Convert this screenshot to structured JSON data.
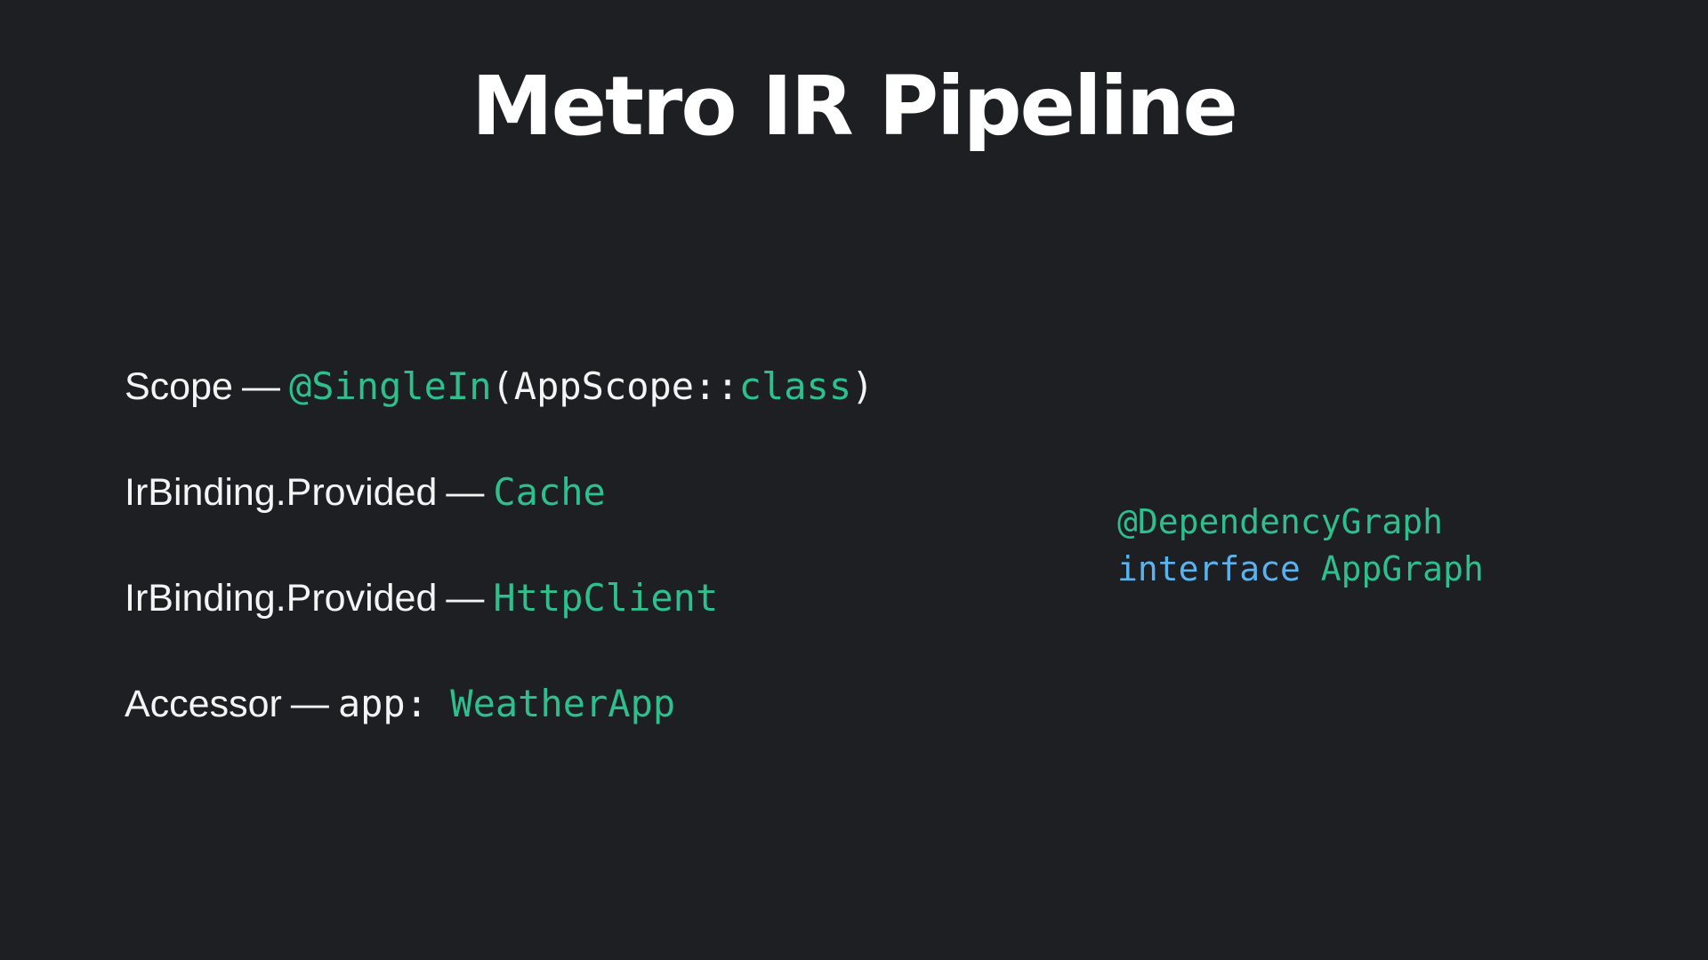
{
  "slide": {
    "title": "Metro IR Pipeline"
  },
  "lines": [
    {
      "label": "Scope",
      "separator": "—",
      "code": [
        {
          "text": "@SingleIn",
          "color": "#2dbf8c"
        },
        {
          "text": "(AppScope",
          "color": "#f4f4f4"
        },
        {
          "text": "::",
          "color": "#f4f4f4"
        },
        {
          "text": "class",
          "color": "#2dbf8c"
        },
        {
          "text": ")",
          "color": "#f4f4f4"
        }
      ]
    },
    {
      "label": "IrBinding.Provided",
      "separator": "—",
      "code": [
        {
          "text": "Cache",
          "color": "#2dbf8c"
        }
      ]
    },
    {
      "label": "IrBinding.Provided",
      "separator": "—",
      "code": [
        {
          "text": "HttpClient",
          "color": "#2dbf8c"
        }
      ]
    },
    {
      "label": "Accessor",
      "separator": "—",
      "code": [
        {
          "text": "app: ",
          "color": "#f4f4f4"
        },
        {
          "text": "WeatherApp",
          "color": "#2dbf8c"
        }
      ]
    }
  ],
  "side_code": {
    "annotation": "@DependencyGraph",
    "keyword": "interface",
    "type_name": "AppGraph"
  },
  "colors": {
    "background": "#1e1f23",
    "accent_green": "#2dbf8c",
    "keyword_blue": "#5bb3ee",
    "text": "#f4f4f4"
  }
}
